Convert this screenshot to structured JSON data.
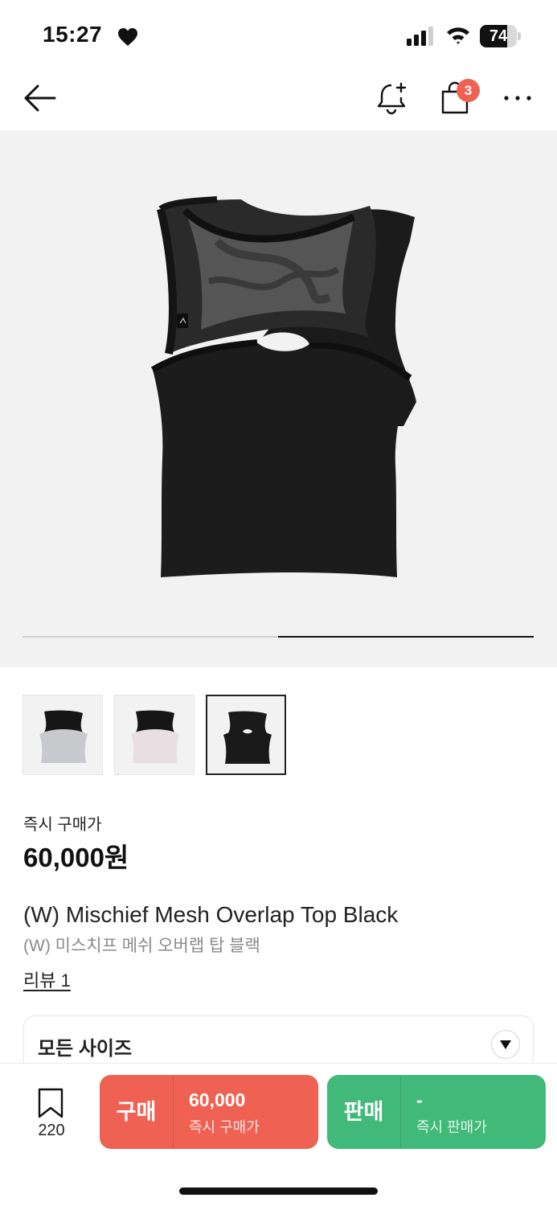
{
  "status_bar": {
    "time": "15:27",
    "battery_level": "74",
    "battery_percent": 74,
    "icons": [
      "heart-icon",
      "cellular-signal-icon",
      "wifi-icon",
      "battery-icon"
    ]
  },
  "nav": {
    "icons": [
      "back-arrow-icon",
      "bell-plus-icon",
      "shopping-bag-icon",
      "more-horizontal-icon"
    ],
    "cart_badge": "3"
  },
  "gallery": {
    "image": "black mesh overlap sleeveless top",
    "image_count": 2,
    "current_image": 2,
    "thumbnails": [
      {
        "name": "thumbnail-gray",
        "color": "#c7c9cc",
        "selected": false
      },
      {
        "name": "thumbnail-pink",
        "color": "#e9dfe3",
        "selected": false
      },
      {
        "name": "thumbnail-black",
        "color": "#1a1a1a",
        "selected": true
      }
    ]
  },
  "price": {
    "label": "즉시 구매가",
    "value": "60,000원"
  },
  "product": {
    "title": "(W) Mischief Mesh Overlap Top Black",
    "subtitle": "(W) 미스치프 메쉬 오버랩 탑 블랙",
    "review_link": "리뷰 1"
  },
  "size_select": {
    "label": "모든 사이즈",
    "icon": "chevron-down-icon"
  },
  "bottom_bar": {
    "wish_count": "220",
    "wish_icon": "bookmark-icon",
    "buy": {
      "kind": "구매",
      "price": "60,000",
      "sub": "즉시 구매가",
      "color": "#ef6253"
    },
    "sell": {
      "kind": "판매",
      "price": "-",
      "sub": "즉시 판매가",
      "color": "#41b979"
    }
  },
  "colors": {
    "accent_red": "#ef6253",
    "accent_green": "#41b979",
    "image_bg": "#f2f2f2"
  }
}
